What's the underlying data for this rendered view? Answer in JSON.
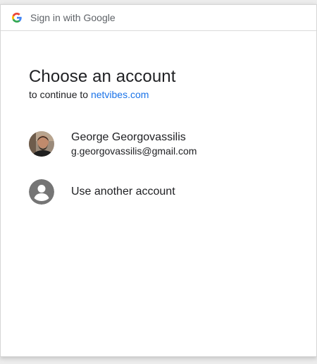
{
  "topbar": {
    "title": "Sign in with Google",
    "icon": "google-g-icon"
  },
  "main": {
    "heading": "Choose an account",
    "subtitle_prefix": "to continue to",
    "subtitle_link": "netvibes.com"
  },
  "accounts": [
    {
      "name": "George Georgovassilis",
      "email": "g.georgovassilis@gmail.com",
      "icon": "user-photo-avatar"
    }
  ],
  "other_account": {
    "label": "Use another account",
    "icon": "generic-person-icon"
  },
  "colors": {
    "link": "#1a73e8",
    "text": "#202124",
    "muted": "#5f6368",
    "avatar_generic": "#757575"
  }
}
